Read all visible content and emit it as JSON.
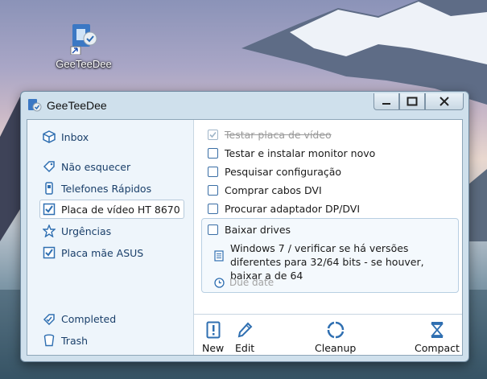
{
  "desktop": {
    "icon_label": "GeeTeeDee"
  },
  "window": {
    "title": "GeeTeeDee",
    "controls": {
      "minimize": "minimize",
      "maximize": "maximize",
      "close": "close"
    }
  },
  "sidebar": {
    "items": [
      {
        "label": "Inbox",
        "icon": "inbox-icon"
      },
      {
        "label": "Não esquecer",
        "icon": "tag-icon"
      },
      {
        "label": "Telefones Rápidos",
        "icon": "phone-icon"
      },
      {
        "label": "Placa de vídeo HT 8670",
        "icon": "checklist-icon",
        "selected": true
      },
      {
        "label": "Urgências",
        "icon": "star-icon"
      },
      {
        "label": "Placa mãe ASUS",
        "icon": "checklist-icon"
      }
    ],
    "bottom": [
      {
        "label": "Completed",
        "icon": "completed-icon"
      },
      {
        "label": "Trash",
        "icon": "trash-icon"
      }
    ]
  },
  "tasks": [
    {
      "label": "Testar placa de vídeo",
      "done": true
    },
    {
      "label": "Testar e instalar monitor novo",
      "done": false
    },
    {
      "label": "Pesquisar configuração",
      "done": false
    },
    {
      "label": "Comprar cabos DVI",
      "done": false
    },
    {
      "label": "Procurar adaptador DP/DVI",
      "done": false
    }
  ],
  "expanded_task": {
    "label": "Baixar drives",
    "note": "Windows 7 / verificar se há versões diferentes para 32/64 bits - se houver, baixar a de 64",
    "due_placeholder": "Due date"
  },
  "toolbar": {
    "new": "New",
    "edit": "Edit",
    "cleanup": "Cleanup",
    "compact": "Compact"
  },
  "colors": {
    "accent": "#2f6fb1",
    "sidebar_bg": "#eef5fb",
    "frame": "#cfe0ec"
  }
}
